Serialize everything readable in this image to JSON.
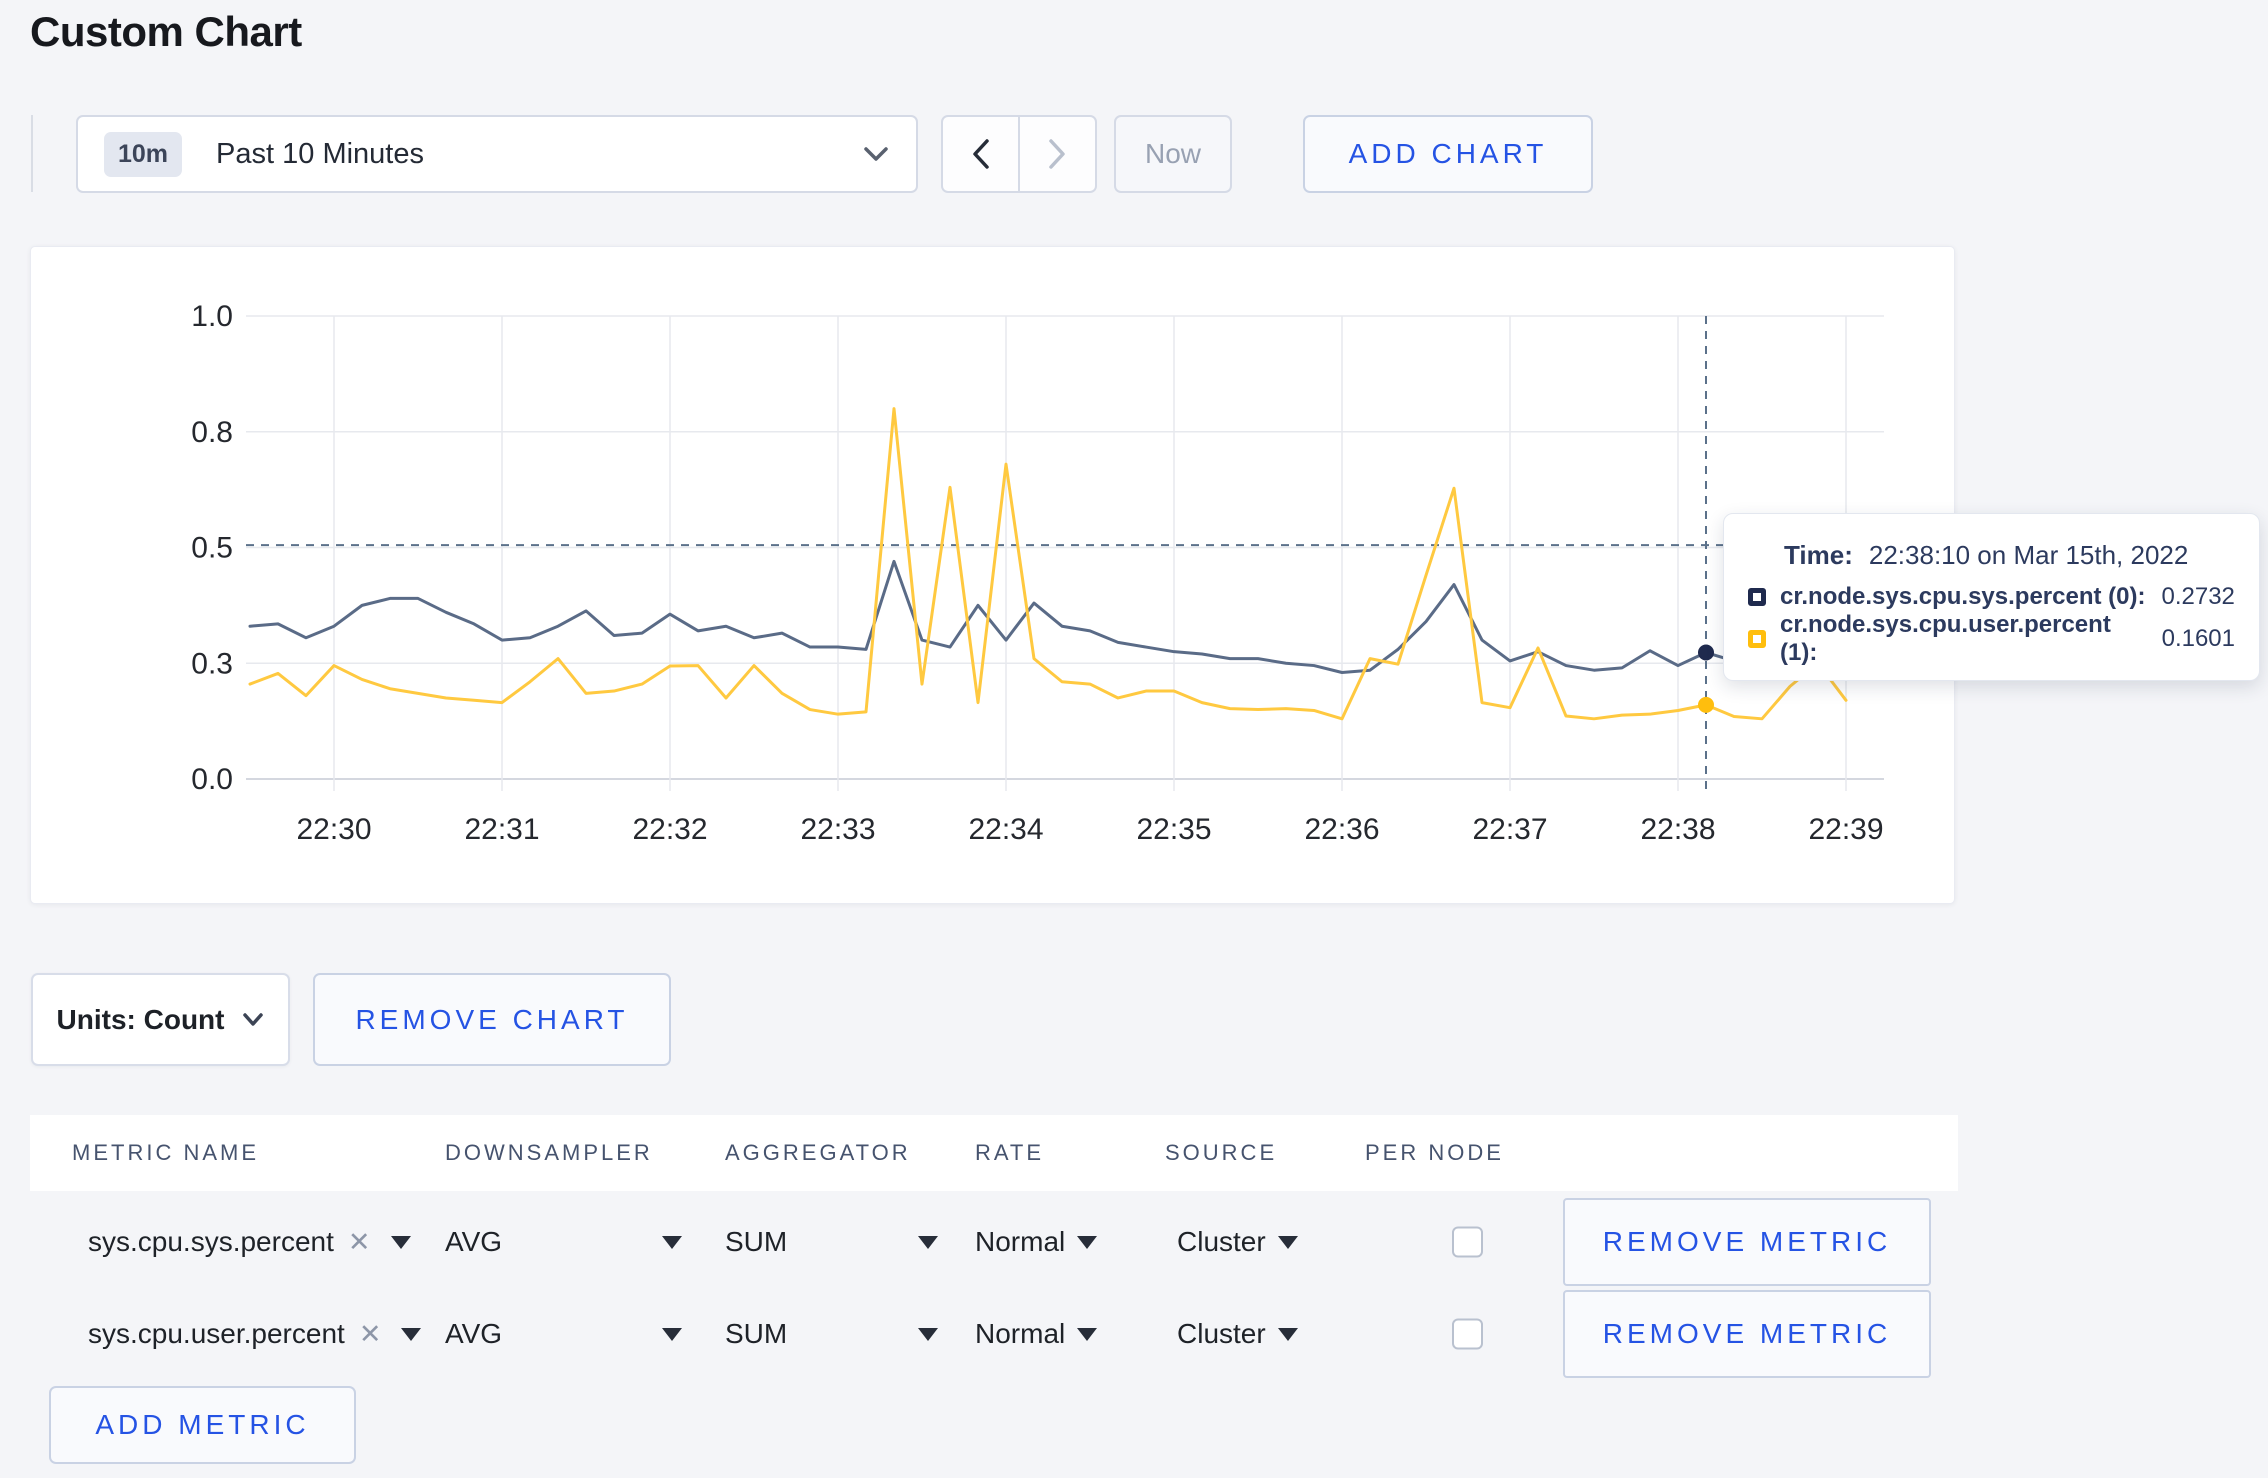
{
  "page": {
    "title": "Custom Chart"
  },
  "toolbar": {
    "range_badge": "10m",
    "range_label": "Past 10 Minutes",
    "now_label": "Now",
    "add_chart_label": "ADD CHART"
  },
  "tooltip": {
    "time_label": "Time:",
    "time_value": "22:38:10 on Mar 15th, 2022",
    "items": [
      {
        "label": "cr.node.sys.cpu.sys.percent (0):",
        "value": "0.2732"
      },
      {
        "label": "cr.node.sys.cpu.user.percent (1):",
        "value": "0.1601"
      }
    ]
  },
  "units": {
    "label": "Units: Count",
    "remove_chart_label": "REMOVE CHART"
  },
  "table": {
    "headers": [
      "METRIC NAME",
      "DOWNSAMPLER",
      "AGGREGATOR",
      "RATE",
      "SOURCE",
      "PER NODE"
    ],
    "remove_metric_label": "REMOVE METRIC",
    "add_metric_label": "ADD METRIC",
    "rows": [
      {
        "name": "sys.cpu.sys.percent",
        "remove_icon": "✕",
        "downsampler": "AVG",
        "aggregator": "SUM",
        "rate": "Normal",
        "source": "Cluster",
        "per_node_checked": false
      },
      {
        "name": "sys.cpu.user.percent",
        "remove_icon": "✕",
        "downsampler": "AVG",
        "aggregator": "SUM",
        "rate": "Normal",
        "source": "Cluster",
        "per_node_checked": false
      }
    ]
  },
  "colors": {
    "accent_blue": "#2553e4",
    "page_bg": "#f4f5f8",
    "grid": "#e7e9ee",
    "crosshair": "#5b718a"
  },
  "chart_data": {
    "type": "line",
    "title": "",
    "xlabel": "",
    "ylabel": "",
    "ylim": [
      0,
      1
    ],
    "grid": true,
    "legend_position": "tooltip",
    "y_ticks": [
      {
        "value": 0,
        "label": "0.0"
      },
      {
        "value": 0.25,
        "label": "0.3"
      },
      {
        "value": 0.5,
        "label": "0.5"
      },
      {
        "value": 0.75,
        "label": "0.8"
      },
      {
        "value": 1,
        "label": "1.0"
      }
    ],
    "x_ticks": [
      "22:30",
      "22:31",
      "22:32",
      "22:33",
      "22:34",
      "22:35",
      "22:36",
      "22:37",
      "22:38",
      "22:39"
    ],
    "times": [
      "22:29:30",
      "22:29:40",
      "22:29:50",
      "22:30:00",
      "22:30:10",
      "22:30:20",
      "22:30:30",
      "22:30:40",
      "22:30:50",
      "22:31:00",
      "22:31:10",
      "22:31:20",
      "22:31:30",
      "22:31:40",
      "22:31:50",
      "22:32:00",
      "22:32:10",
      "22:32:20",
      "22:32:30",
      "22:32:40",
      "22:32:50",
      "22:33:00",
      "22:33:10",
      "22:33:20",
      "22:33:30",
      "22:33:40",
      "22:33:50",
      "22:34:00",
      "22:34:10",
      "22:34:20",
      "22:34:30",
      "22:34:40",
      "22:34:50",
      "22:35:00",
      "22:35:10",
      "22:35:20",
      "22:35:30",
      "22:35:40",
      "22:35:50",
      "22:36:00",
      "22:36:10",
      "22:36:20",
      "22:36:30",
      "22:36:40",
      "22:36:50",
      "22:37:00",
      "22:37:10",
      "22:37:20",
      "22:37:30",
      "22:37:40",
      "22:37:50",
      "22:38:00",
      "22:38:10",
      "22:38:20",
      "22:38:30",
      "22:38:40",
      "22:38:50",
      "22:39:00",
      "22:39:10"
    ],
    "series": [
      {
        "name": "cr.node.sys.cpu.sys.percent (0)",
        "color": "#5a6b87",
        "swatch": "#1f2a4e",
        "values": [
          0.33,
          0.335,
          0.305,
          0.33,
          0.375,
          0.39,
          0.39,
          0.36,
          0.335,
          0.3,
          0.305,
          0.33,
          0.363,
          0.31,
          0.315,
          0.356,
          0.32,
          0.33,
          0.305,
          0.315,
          0.285,
          0.285,
          0.28,
          0.47,
          0.3,
          0.285,
          0.375,
          0.3,
          0.38,
          0.33,
          0.32,
          0.295,
          0.285,
          0.275,
          0.27,
          0.26,
          0.26,
          0.25,
          0.245,
          0.23,
          0.235,
          0.28,
          0.34,
          0.42,
          0.3,
          0.255,
          0.275,
          0.245,
          0.235,
          0.24,
          0.277,
          0.245,
          0.2732,
          0.255,
          null,
          null,
          null,
          null,
          null
        ]
      },
      {
        "name": "cr.node.sys.cpu.user.percent (1)",
        "color": "#ffc940",
        "swatch": "#ffbe0d",
        "values": [
          0.205,
          0.228,
          0.18,
          0.245,
          0.215,
          0.195,
          0.185,
          0.175,
          0.17,
          0.165,
          0.21,
          0.26,
          0.185,
          0.19,
          0.205,
          0.244,
          0.245,
          0.175,
          0.245,
          0.185,
          0.15,
          0.14,
          0.145,
          0.8,
          0.205,
          0.63,
          0.165,
          0.68,
          0.26,
          0.21,
          0.205,
          0.175,
          0.19,
          0.19,
          0.165,
          0.152,
          0.15,
          0.152,
          0.148,
          0.13,
          0.26,
          0.248,
          0.44,
          0.628,
          0.165,
          0.154,
          0.283,
          0.136,
          0.13,
          0.138,
          0.14,
          0.148,
          0.1601,
          0.135,
          0.13,
          0.2,
          0.25,
          0.17,
          null
        ]
      }
    ],
    "crosshair": {
      "time": "22:38:10",
      "hline_value": 0.505,
      "point_values": [
        0.2732,
        0.1601
      ]
    }
  }
}
